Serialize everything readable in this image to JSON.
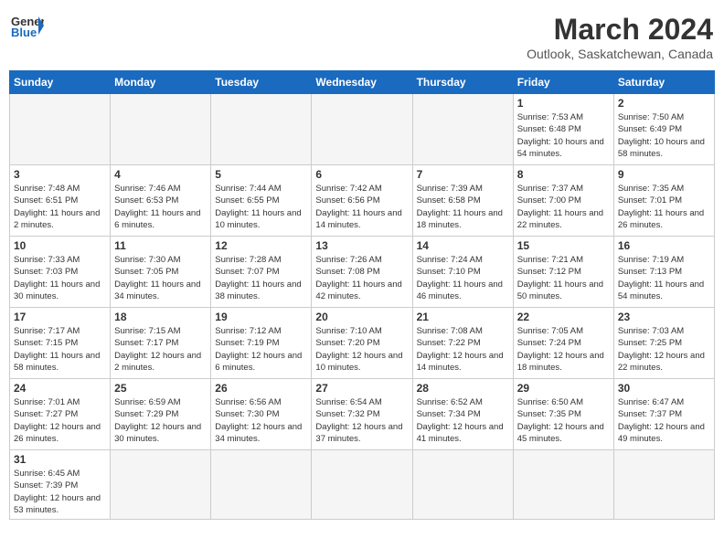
{
  "header": {
    "logo_general": "General",
    "logo_blue": "Blue",
    "month_title": "March 2024",
    "subtitle": "Outlook, Saskatchewan, Canada"
  },
  "weekdays": [
    "Sunday",
    "Monday",
    "Tuesday",
    "Wednesday",
    "Thursday",
    "Friday",
    "Saturday"
  ],
  "weeks": [
    [
      {
        "day": "",
        "info": ""
      },
      {
        "day": "",
        "info": ""
      },
      {
        "day": "",
        "info": ""
      },
      {
        "day": "",
        "info": ""
      },
      {
        "day": "",
        "info": ""
      },
      {
        "day": "1",
        "info": "Sunrise: 7:53 AM\nSunset: 6:48 PM\nDaylight: 10 hours\nand 54 minutes."
      },
      {
        "day": "2",
        "info": "Sunrise: 7:50 AM\nSunset: 6:49 PM\nDaylight: 10 hours\nand 58 minutes."
      }
    ],
    [
      {
        "day": "3",
        "info": "Sunrise: 7:48 AM\nSunset: 6:51 PM\nDaylight: 11 hours\nand 2 minutes."
      },
      {
        "day": "4",
        "info": "Sunrise: 7:46 AM\nSunset: 6:53 PM\nDaylight: 11 hours\nand 6 minutes."
      },
      {
        "day": "5",
        "info": "Sunrise: 7:44 AM\nSunset: 6:55 PM\nDaylight: 11 hours\nand 10 minutes."
      },
      {
        "day": "6",
        "info": "Sunrise: 7:42 AM\nSunset: 6:56 PM\nDaylight: 11 hours\nand 14 minutes."
      },
      {
        "day": "7",
        "info": "Sunrise: 7:39 AM\nSunset: 6:58 PM\nDaylight: 11 hours\nand 18 minutes."
      },
      {
        "day": "8",
        "info": "Sunrise: 7:37 AM\nSunset: 7:00 PM\nDaylight: 11 hours\nand 22 minutes."
      },
      {
        "day": "9",
        "info": "Sunrise: 7:35 AM\nSunset: 7:01 PM\nDaylight: 11 hours\nand 26 minutes."
      }
    ],
    [
      {
        "day": "10",
        "info": "Sunrise: 7:33 AM\nSunset: 7:03 PM\nDaylight: 11 hours\nand 30 minutes."
      },
      {
        "day": "11",
        "info": "Sunrise: 7:30 AM\nSunset: 7:05 PM\nDaylight: 11 hours\nand 34 minutes."
      },
      {
        "day": "12",
        "info": "Sunrise: 7:28 AM\nSunset: 7:07 PM\nDaylight: 11 hours\nand 38 minutes."
      },
      {
        "day": "13",
        "info": "Sunrise: 7:26 AM\nSunset: 7:08 PM\nDaylight: 11 hours\nand 42 minutes."
      },
      {
        "day": "14",
        "info": "Sunrise: 7:24 AM\nSunset: 7:10 PM\nDaylight: 11 hours\nand 46 minutes."
      },
      {
        "day": "15",
        "info": "Sunrise: 7:21 AM\nSunset: 7:12 PM\nDaylight: 11 hours\nand 50 minutes."
      },
      {
        "day": "16",
        "info": "Sunrise: 7:19 AM\nSunset: 7:13 PM\nDaylight: 11 hours\nand 54 minutes."
      }
    ],
    [
      {
        "day": "17",
        "info": "Sunrise: 7:17 AM\nSunset: 7:15 PM\nDaylight: 11 hours\nand 58 minutes."
      },
      {
        "day": "18",
        "info": "Sunrise: 7:15 AM\nSunset: 7:17 PM\nDaylight: 12 hours\nand 2 minutes."
      },
      {
        "day": "19",
        "info": "Sunrise: 7:12 AM\nSunset: 7:19 PM\nDaylight: 12 hours\nand 6 minutes."
      },
      {
        "day": "20",
        "info": "Sunrise: 7:10 AM\nSunset: 7:20 PM\nDaylight: 12 hours\nand 10 minutes."
      },
      {
        "day": "21",
        "info": "Sunrise: 7:08 AM\nSunset: 7:22 PM\nDaylight: 12 hours\nand 14 minutes."
      },
      {
        "day": "22",
        "info": "Sunrise: 7:05 AM\nSunset: 7:24 PM\nDaylight: 12 hours\nand 18 minutes."
      },
      {
        "day": "23",
        "info": "Sunrise: 7:03 AM\nSunset: 7:25 PM\nDaylight: 12 hours\nand 22 minutes."
      }
    ],
    [
      {
        "day": "24",
        "info": "Sunrise: 7:01 AM\nSunset: 7:27 PM\nDaylight: 12 hours\nand 26 minutes."
      },
      {
        "day": "25",
        "info": "Sunrise: 6:59 AM\nSunset: 7:29 PM\nDaylight: 12 hours\nand 30 minutes."
      },
      {
        "day": "26",
        "info": "Sunrise: 6:56 AM\nSunset: 7:30 PM\nDaylight: 12 hours\nand 34 minutes."
      },
      {
        "day": "27",
        "info": "Sunrise: 6:54 AM\nSunset: 7:32 PM\nDaylight: 12 hours\nand 37 minutes."
      },
      {
        "day": "28",
        "info": "Sunrise: 6:52 AM\nSunset: 7:34 PM\nDaylight: 12 hours\nand 41 minutes."
      },
      {
        "day": "29",
        "info": "Sunrise: 6:50 AM\nSunset: 7:35 PM\nDaylight: 12 hours\nand 45 minutes."
      },
      {
        "day": "30",
        "info": "Sunrise: 6:47 AM\nSunset: 7:37 PM\nDaylight: 12 hours\nand 49 minutes."
      }
    ],
    [
      {
        "day": "31",
        "info": "Sunrise: 6:45 AM\nSunset: 7:39 PM\nDaylight: 12 hours\nand 53 minutes."
      },
      {
        "day": "",
        "info": ""
      },
      {
        "day": "",
        "info": ""
      },
      {
        "day": "",
        "info": ""
      },
      {
        "day": "",
        "info": ""
      },
      {
        "day": "",
        "info": ""
      },
      {
        "day": "",
        "info": ""
      }
    ]
  ]
}
